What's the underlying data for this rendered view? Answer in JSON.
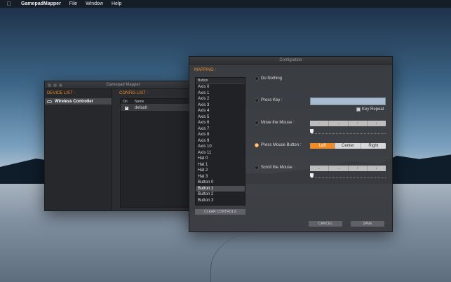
{
  "menubar": {
    "apple_icon": "apple-logo-icon",
    "app_name": "GamepadMapper",
    "items": [
      "File",
      "Window",
      "Help"
    ]
  },
  "main_window": {
    "title": "Gamepad Mapper",
    "device_list_label": "DEVICE LIST :",
    "devices": [
      "Wireless Controller"
    ],
    "config_list_label": "CONFIG LIST :",
    "columns": {
      "on": "On",
      "name": "Name"
    },
    "configs": [
      {
        "on": "✓",
        "name": "default"
      }
    ]
  },
  "dialog": {
    "title": "Configration",
    "mapping_label": "MAPPING :",
    "list_header": "Button",
    "buttons": [
      "Axis 0",
      "Axis 1",
      "Axis 2",
      "Axis 3",
      "Axis 4",
      "Axis 5",
      "Axis 6",
      "Axis 7",
      "Axis 8",
      "Axis 9",
      "Axis 10",
      "Axis 11",
      "Hat 0",
      "Hat 1",
      "Hat 2",
      "Hat 3",
      "Button 0",
      "Button 1",
      "Button 2",
      "Button 3"
    ],
    "selected_button": "Button 1",
    "clear_label": "CLEAR CONTROLS",
    "options": {
      "do_nothing": "Do Nothing",
      "press_key": "Press Key :",
      "key_repeat": "Key Repeat",
      "move_mouse": "Move the Mouse :",
      "press_mouse": "Press Mouse Button :",
      "scroll_mouse": "Scroll the Mouse :"
    },
    "selected_option": "press_mouse",
    "direction_arrows": [
      "←",
      "→",
      "↑",
      "↓"
    ],
    "mouse_buttons": [
      "Left",
      "Center",
      "Right"
    ],
    "selected_mouse_button": "Left",
    "move_speed": 0,
    "scroll_speed": 0,
    "cancel_label": "CANCEL",
    "save_label": "SAVE",
    "accent_color": "#f08b2a"
  }
}
